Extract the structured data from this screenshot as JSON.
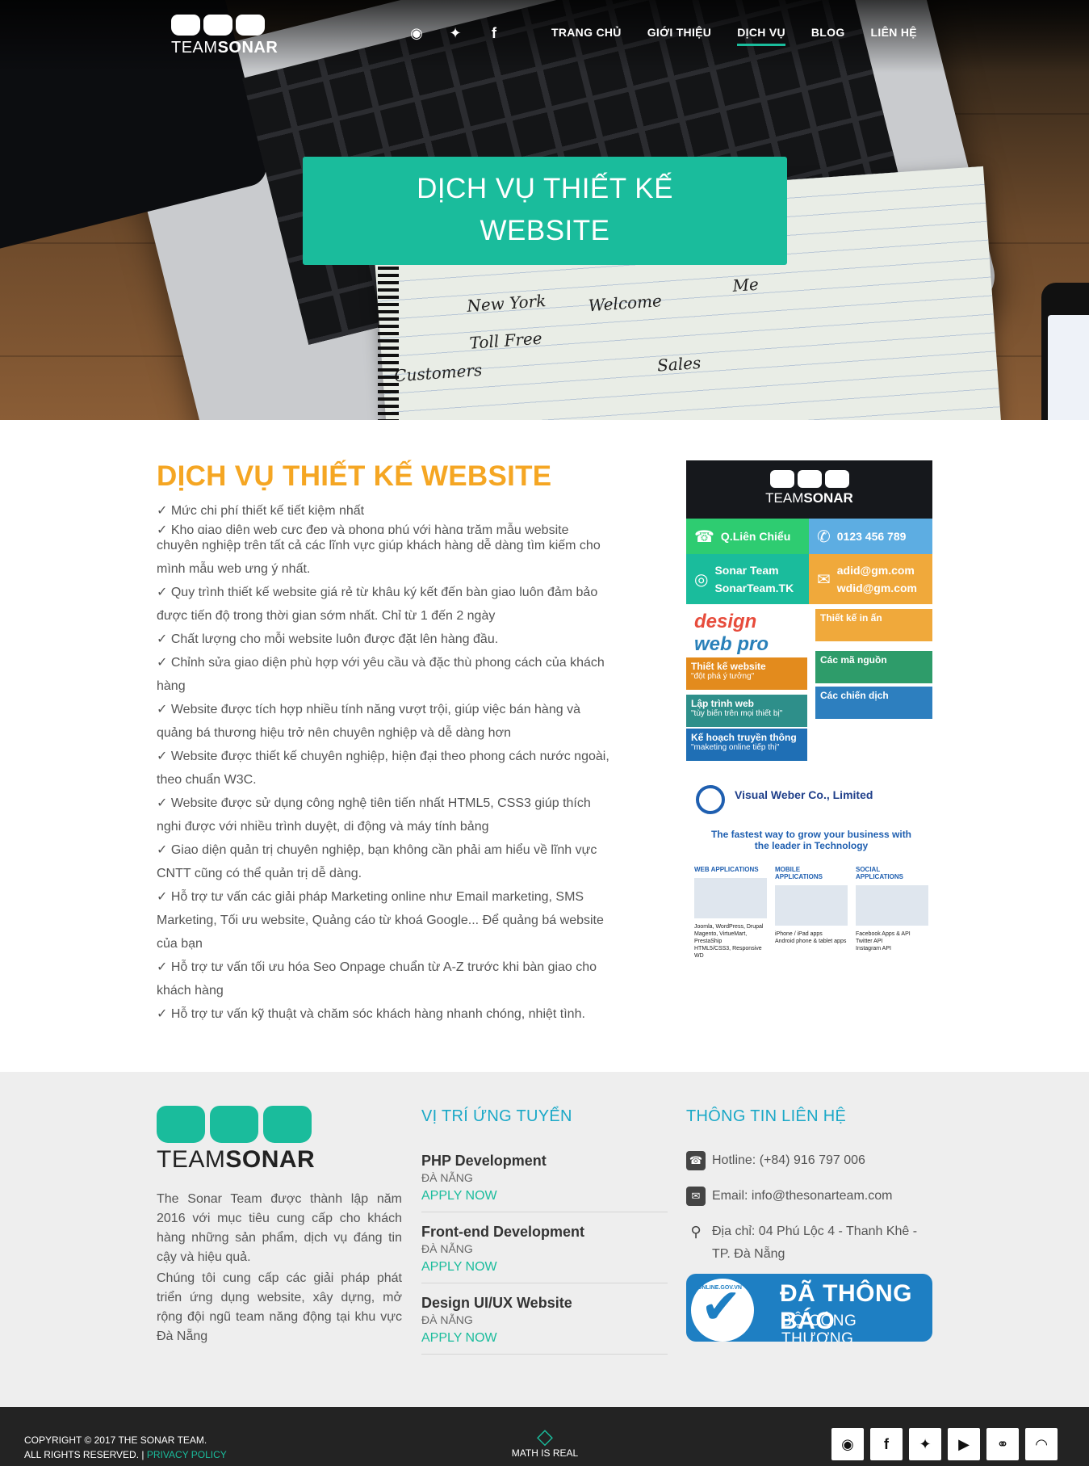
{
  "header": {
    "logo_text_light": "TEAM",
    "logo_text_bold": "SONAR",
    "social": [
      {
        "icon": "github-icon",
        "glyph": "◉"
      },
      {
        "icon": "twitter-icon",
        "glyph": "✦"
      },
      {
        "icon": "facebook-icon",
        "glyph": "f"
      }
    ],
    "nav": [
      "TRANG CHỦ",
      "GIỚI THIỆU",
      "DỊCH VỤ",
      "BLOG",
      "LIÊN HỆ"
    ],
    "nav_active": "DỊCH VỤ",
    "accent": "#1abc9c"
  },
  "hero": {
    "banner_line1": "DỊCH VỤ THIẾT KẾ",
    "banner_line2": "WEBSITE",
    "sketch": [
      "New York",
      "Toll Free",
      "Welcome",
      "Me",
      "Customers",
      "Sales"
    ]
  },
  "main": {
    "title": "DỊCH VỤ THIẾT KẾ WEBSITE",
    "items": [
      "✓ Mức chi phí thiết kế tiết kiệm nhất",
      "✓ Kho giao diện web cực đẹp và phong phú với hàng trăm mẫu website",
      "chuyên nghiệp trên tất cả các lĩnh vực giúp khách hàng dễ dàng tìm kiếm cho",
      "mình mẫu web ưng ý nhất.",
      "✓ Quy trình thiết kế website giá rẻ từ khâu ký kết đến bàn giao luôn đảm bảo",
      "được tiến độ trong thời gian sớm nhất. Chỉ từ 1 đến 2 ngày",
      "✓ Chất lượng cho mỗi website luôn được đặt lên hàng đầu.",
      "✓ Chỉnh sửa giao diện phù hợp với yêu cầu và đặc thù phong cách của khách",
      "hàng",
      "✓ Website được tích hợp nhiều tính năng vượt trội, giúp việc bán hàng và",
      "quảng bá thương hiệu trở nên chuyên nghiệp và dễ dàng hơn",
      "✓ Website được thiết kế chuyên nghiệp, hiện đại theo phong cách nước ngoài,",
      "theo chuẩn W3C.",
      "✓ Website được sử dụng công nghệ tiên tiến nhất HTML5, CSS3 giúp thích",
      "nghi được với nhiều trình duyệt, di động và máy tính bảng",
      "✓ Giao diện quản trị chuyên nghiệp, bạn không cần phải am hiểu về lĩnh vực",
      "CNTT cũng có thể quản trị dễ dàng.",
      "✓ Hỗ trợ tư vấn các giải pháp Marketing online như Email marketing, SMS",
      "Marketing, Tối ưu website, Quảng cáo từ khoá Google... Để quảng bá website",
      "của bạn",
      "✓ Hỗ trợ tư vấn tối ưu hóa Seo Onpage chuẩn từ A-Z trước khi bàn giao cho",
      "khách hàng",
      "✓ Hỗ trợ tư vấn kỹ thuật và chăm sóc khách hàng nhanh chóng, nhiệt tình."
    ]
  },
  "sidebar": {
    "card": {
      "logo_light": "TEAM",
      "logo_bold": "SONAR",
      "location": "Q.Liên Chiểu",
      "phone": "0123 456 789",
      "site_name": "Sonar Team",
      "site_domain": "SonarTeam.TK",
      "email1": "adid@gm.com",
      "email2": "wdid@gm.com"
    },
    "ad1": {
      "brand1": "design",
      "brand2": "web pro",
      "bands": [
        {
          "title": "Thiết kế in ấn",
          "color": "#f0a93b"
        },
        {
          "title": "Thiết kế website",
          "sub": "\"đột phá ý tưởng\"",
          "color": "#e38b1d"
        },
        {
          "title": "Các mã nguồn",
          "color": "#2e9c6a"
        },
        {
          "title": "Lập trình web",
          "sub": "\"tùy biến trên mọi thiết bị\"",
          "color": "#2e8f8a"
        },
        {
          "title": "Các chiến dịch",
          "color": "#2d7fbf"
        },
        {
          "title": "Kế hoạch truyền thông",
          "sub": "\"maketing online tiếp thị\"",
          "color": "#1f6fb5"
        }
      ]
    },
    "ad2": {
      "title": "Visual Weber Co., Limited",
      "tagline_1": "The fastest way to grow your business with",
      "tagline_2": "the leader in Technology",
      "cols": [
        {
          "h": "WEB APPLICATIONS",
          "items": [
            "Joomla, WordPress, Drupal",
            "Magento, VirtueMart, PrestaShip",
            "HTML5/CSS3, Responsive WD"
          ]
        },
        {
          "h": "MOBILE APPLICATIONS",
          "items": [
            "iPhone / iPad apps",
            "Android phone & tablet apps"
          ]
        },
        {
          "h": "SOCIAL APPLICATIONS",
          "items": [
            "Facebook Apps & API",
            "Twitter API",
            "Instagram API"
          ]
        }
      ]
    }
  },
  "footer": {
    "logo_light": "TEAM",
    "logo_bold": "SONAR",
    "about_1": "The Sonar Team được thành lập năm 2016 với mục tiêu cung cấp cho khách hàng những sản phẩm, dịch vụ đáng tin cậy và hiệu quả.",
    "about_2": "Chúng tôi cung cấp các giải pháp phát triển ứng dụng website, xây dựng, mở rộng đội ngũ team năng động tại khu vực Đà Nẵng",
    "jobs_heading": "VỊ TRÍ ỨNG TUYỂN",
    "jobs": [
      {
        "title": "PHP Development",
        "city": "ĐÀ NẴNG",
        "apply": "APPLY NOW"
      },
      {
        "title": "Front-end Development",
        "city": "ĐÀ NẴNG",
        "apply": "APPLY NOW"
      },
      {
        "title": "Design UI/UX Website",
        "city": "ĐÀ NẴNG",
        "apply": "APPLY NOW"
      }
    ],
    "contact_heading": "THÔNG TIN LIÊN HỆ",
    "hotline": "Hotline: (+84) 916 797 006",
    "email": "Email: info@thesonarteam.com",
    "address": "Địa chỉ: 04 Phú Lộc 4 - Thanh Khê - TP. Đà Nẵng",
    "badge_l1": "ĐÃ THÔNG BÁO",
    "badge_l2": "BỘ CÔNG THƯƠNG",
    "badge_ring": "ONLINE.GOV.VN"
  },
  "bottom": {
    "copy_1": "COPYRIGHT © 2017 THE SONAR TEAM.",
    "copy_2": "ALL RIGHTS RESERVED. |",
    "privacy": "PRIVACY POLICY",
    "center": "MATH IS REAL",
    "icons": [
      {
        "icon": "github-icon",
        "glyph": "◉"
      },
      {
        "icon": "facebook-icon",
        "glyph": "f"
      },
      {
        "icon": "twitter-icon",
        "glyph": "✦"
      },
      {
        "icon": "youtube-icon",
        "glyph": "▶"
      },
      {
        "icon": "link-icon",
        "glyph": "⚭"
      },
      {
        "icon": "rss-icon",
        "glyph": "◠"
      }
    ]
  }
}
